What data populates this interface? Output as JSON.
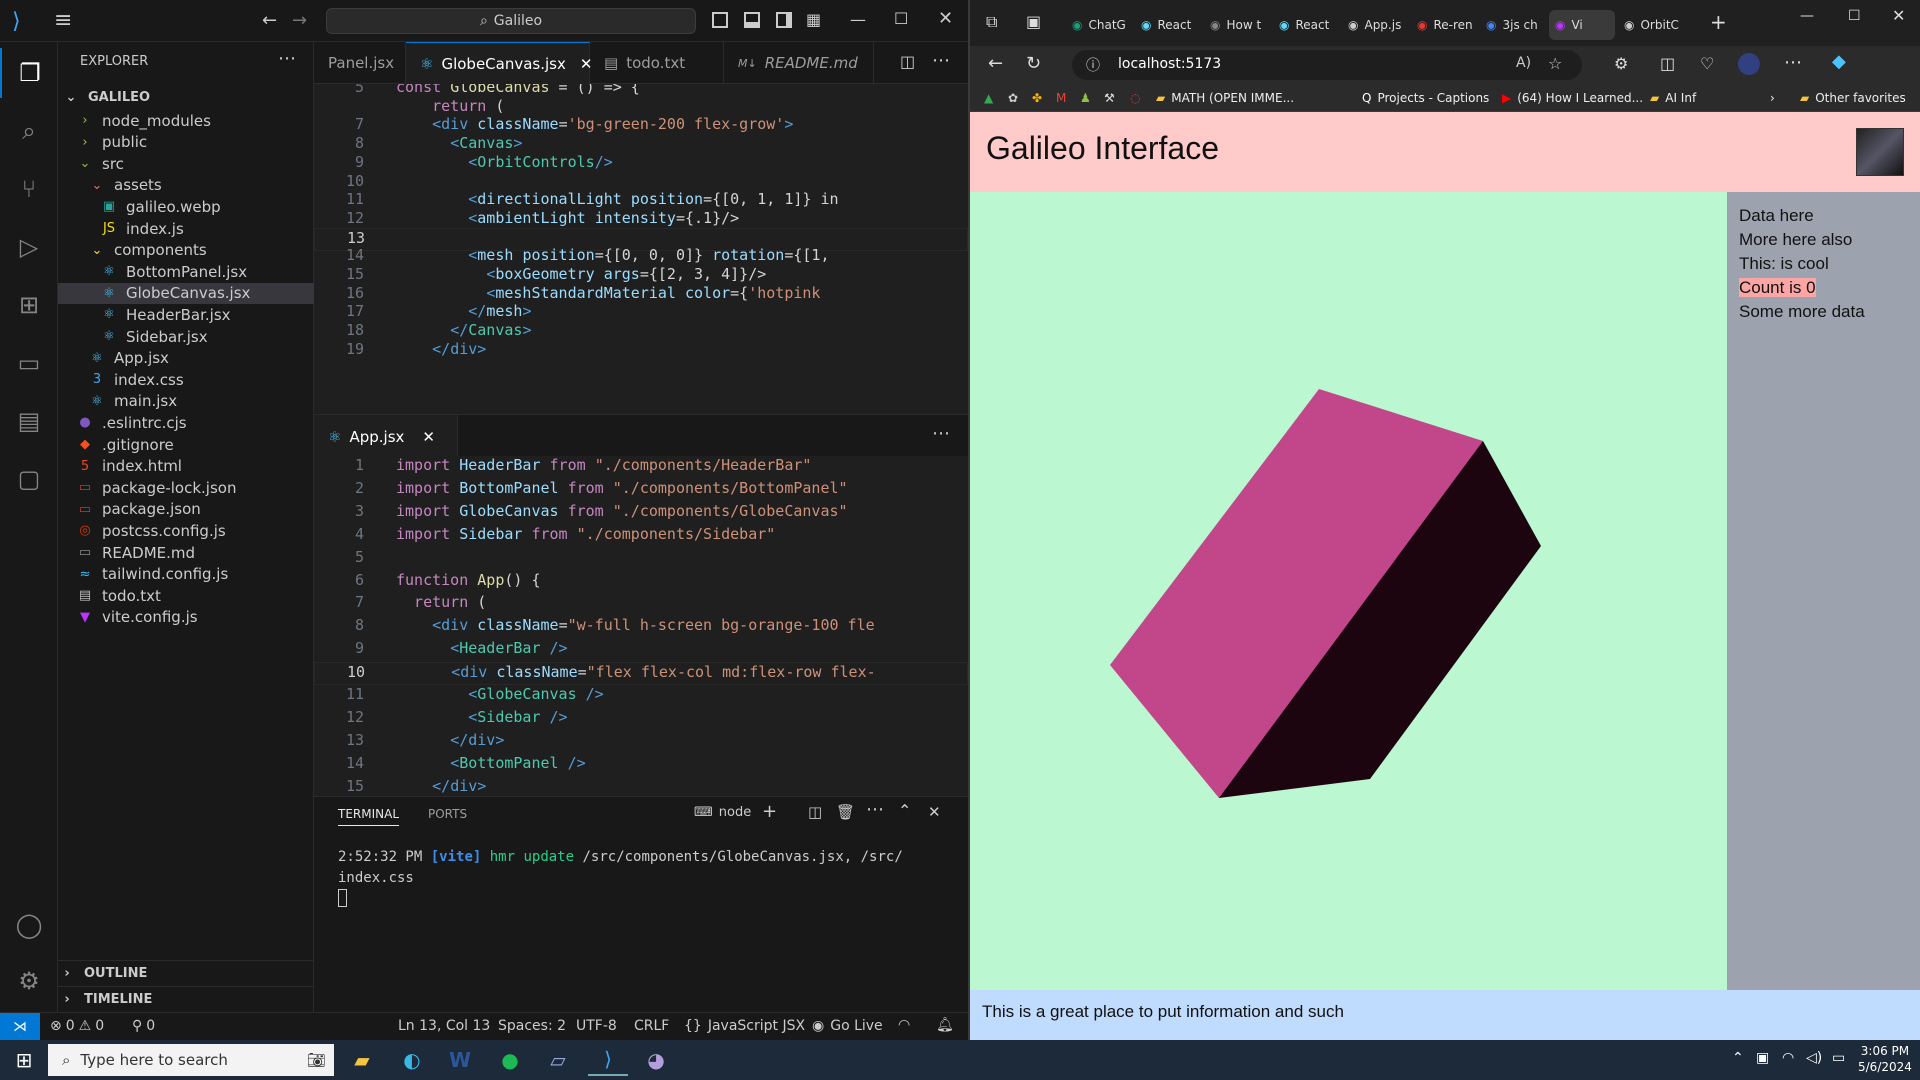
{
  "vscode": {
    "search": "Galileo",
    "explorer_title": "EXPLORER",
    "root": "GALILEO",
    "tree": [
      {
        "label": "node_modules",
        "icon": "›",
        "icolor": "#8bc34a",
        "depth": 1,
        "type": "folder"
      },
      {
        "label": "public",
        "icon": "›",
        "icolor": "#8bc34a",
        "depth": 1,
        "type": "folder"
      },
      {
        "label": "src",
        "icon": "⌄",
        "icolor": "#8bc34a",
        "depth": 1,
        "type": "folder"
      },
      {
        "label": "assets",
        "icon": "⌄",
        "icolor": "#e57373",
        "depth": 2,
        "type": "folder"
      },
      {
        "label": "galileo.webp",
        "icon": "▣",
        "icolor": "#26a69a",
        "depth": 3,
        "type": "file"
      },
      {
        "label": "index.js",
        "icon": "JS",
        "icolor": "#f5de19",
        "depth": 3,
        "type": "file"
      },
      {
        "label": "components",
        "icon": "⌄",
        "icolor": "#fdd835",
        "depth": 2,
        "type": "folder"
      },
      {
        "label": "BottomPanel.jsx",
        "icon": "⚛",
        "icolor": "#4fc3f7",
        "depth": 3,
        "type": "file"
      },
      {
        "label": "GlobeCanvas.jsx",
        "icon": "⚛",
        "icolor": "#4fc3f7",
        "depth": 3,
        "type": "file",
        "selected": true
      },
      {
        "label": "HeaderBar.jsx",
        "icon": "⚛",
        "icolor": "#4fc3f7",
        "depth": 3,
        "type": "file"
      },
      {
        "label": "Sidebar.jsx",
        "icon": "⚛",
        "icolor": "#4fc3f7",
        "depth": 3,
        "type": "file"
      },
      {
        "label": "App.jsx",
        "icon": "⚛",
        "icolor": "#4fc3f7",
        "depth": 2,
        "type": "file"
      },
      {
        "label": "index.css",
        "icon": "3",
        "icolor": "#42a5f5",
        "depth": 2,
        "type": "file"
      },
      {
        "label": "main.jsx",
        "icon": "⚛",
        "icolor": "#4fc3f7",
        "depth": 2,
        "type": "file"
      },
      {
        "label": ".eslintrc.cjs",
        "icon": "●",
        "icolor": "#7e57c2",
        "depth": 1,
        "type": "file"
      },
      {
        "label": ".gitignore",
        "icon": "◆",
        "icolor": "#f4511e",
        "depth": 1,
        "type": "file"
      },
      {
        "label": "index.html",
        "icon": "5",
        "icolor": "#e44d26",
        "depth": 1,
        "type": "file"
      },
      {
        "label": "package-lock.json",
        "icon": "▭",
        "icolor": "#cb3837",
        "depth": 1,
        "type": "file"
      },
      {
        "label": "package.json",
        "icon": "▭",
        "icolor": "#cb3837",
        "depth": 1,
        "type": "file"
      },
      {
        "label": "postcss.config.js",
        "icon": "◎",
        "icolor": "#dd3a0a",
        "depth": 1,
        "type": "file"
      },
      {
        "label": "README.md",
        "icon": "▭",
        "icolor": "#8a8a8a",
        "depth": 1,
        "type": "file"
      },
      {
        "label": "tailwind.config.js",
        "icon": "≈",
        "icolor": "#38bdf8",
        "depth": 1,
        "type": "file"
      },
      {
        "label": "todo.txt",
        "icon": "▤",
        "icolor": "#bbbbbb",
        "depth": 1,
        "type": "file"
      },
      {
        "label": "vite.config.js",
        "icon": "▼",
        "icolor": "#bd34fe",
        "depth": 1,
        "type": "file"
      }
    ],
    "outline": "OUTLINE",
    "timeline": "TIMELINE",
    "tabs": [
      {
        "label": "Panel.jsx",
        "icon": ""
      },
      {
        "label": "GlobeCanvas.jsx",
        "icon": "⚛",
        "active": true
      },
      {
        "label": "todo.txt",
        "icon": "▤"
      },
      {
        "label": "README.md",
        "icon": "M↓"
      }
    ],
    "editor1": [
      {
        "n": "5",
        "t": [
          [
            "kw",
            "const "
          ],
          [
            "fn",
            "GlobeCanvas"
          ],
          [
            "pn",
            " = () => {"
          ]
        ]
      },
      {
        "n": "",
        "t": [
          [
            "kw",
            "    return "
          ],
          [
            "pn",
            "("
          ]
        ]
      },
      {
        "n": "7",
        "t": [
          [
            "pn",
            "    "
          ],
          [
            "tg",
            "<"
          ],
          [
            "tg",
            "div "
          ],
          [
            "at",
            "className"
          ],
          [
            "pn",
            "="
          ],
          [
            "st",
            "'bg-green-200 flex-grow'"
          ],
          [
            "tg",
            ">"
          ]
        ]
      },
      {
        "n": "8",
        "t": [
          [
            "pn",
            "      "
          ],
          [
            "tg",
            "<"
          ],
          [
            "tgn",
            "Canvas"
          ],
          [
            "tg",
            ">"
          ]
        ]
      },
      {
        "n": "9",
        "t": [
          [
            "pn",
            "        "
          ],
          [
            "tg",
            "<"
          ],
          [
            "tgn",
            "OrbitControls"
          ],
          [
            "tg",
            "/>"
          ]
        ]
      },
      {
        "n": "10",
        "t": []
      },
      {
        "n": "11",
        "t": [
          [
            "pn",
            "        "
          ],
          [
            "tg",
            "<"
          ],
          [
            "at",
            "directionalLight "
          ],
          [
            "at",
            "position"
          ],
          [
            "pn",
            "={[0, 1, 1]} in"
          ]
        ]
      },
      {
        "n": "12",
        "t": [
          [
            "pn",
            "        "
          ],
          [
            "tg",
            "<"
          ],
          [
            "at",
            "ambientLight "
          ],
          [
            "at",
            "intensity"
          ],
          [
            "pn",
            "={.1}/>"
          ]
        ]
      },
      {
        "n": "13",
        "t": [],
        "cur": true
      },
      {
        "n": "14",
        "t": [
          [
            "pn",
            "        "
          ],
          [
            "tg",
            "<"
          ],
          [
            "at",
            "mesh "
          ],
          [
            "at",
            "position"
          ],
          [
            "pn",
            "={[0, 0, 0]} "
          ],
          [
            "at",
            "rotation"
          ],
          [
            "pn",
            "={[1,"
          ]
        ]
      },
      {
        "n": "15",
        "t": [
          [
            "pn",
            "          "
          ],
          [
            "tg",
            "<"
          ],
          [
            "at",
            "boxGeometry "
          ],
          [
            "at",
            "args"
          ],
          [
            "pn",
            "={[2, 3, 4]}/>"
          ]
        ]
      },
      {
        "n": "16",
        "t": [
          [
            "pn",
            "          "
          ],
          [
            "tg",
            "<"
          ],
          [
            "at",
            "meshStandardMaterial "
          ],
          [
            "at",
            "color"
          ],
          [
            "pn",
            "={"
          ],
          [
            "st",
            "'hotpink"
          ]
        ]
      },
      {
        "n": "17",
        "t": [
          [
            "pn",
            "        "
          ],
          [
            "tg",
            "</"
          ],
          [
            "at",
            "mesh"
          ],
          [
            "tg",
            ">"
          ]
        ]
      },
      {
        "n": "18",
        "t": [
          [
            "pn",
            "      "
          ],
          [
            "tg",
            "</"
          ],
          [
            "tgn",
            "Canvas"
          ],
          [
            "tg",
            ">"
          ]
        ]
      },
      {
        "n": "19",
        "t": [
          [
            "pn",
            "    "
          ],
          [
            "tg",
            "</"
          ],
          [
            "tg",
            "div"
          ],
          [
            "tg",
            ">"
          ]
        ]
      }
    ],
    "app_tab": "App.jsx",
    "editor2": [
      {
        "n": "1",
        "t": [
          [
            "kw",
            "import "
          ],
          [
            "at",
            "HeaderBar "
          ],
          [
            "kw",
            "from "
          ],
          [
            "st",
            "\"./components/HeaderBar\""
          ]
        ]
      },
      {
        "n": "2",
        "t": [
          [
            "kw",
            "import "
          ],
          [
            "at",
            "BottomPanel "
          ],
          [
            "kw",
            "from "
          ],
          [
            "st",
            "\"./components/BottomPanel\""
          ]
        ]
      },
      {
        "n": "3",
        "t": [
          [
            "kw",
            "import "
          ],
          [
            "at",
            "GlobeCanvas "
          ],
          [
            "kw",
            "from "
          ],
          [
            "st",
            "\"./components/GlobeCanvas\""
          ]
        ]
      },
      {
        "n": "4",
        "t": [
          [
            "kw",
            "import "
          ],
          [
            "at",
            "Sidebar "
          ],
          [
            "kw",
            "from "
          ],
          [
            "st",
            "\"./components/Sidebar\""
          ]
        ]
      },
      {
        "n": "5",
        "t": []
      },
      {
        "n": "6",
        "t": [
          [
            "kw",
            "function "
          ],
          [
            "fn",
            "App"
          ],
          [
            "pn",
            "() {"
          ]
        ]
      },
      {
        "n": "7",
        "t": [
          [
            "kw",
            "  return "
          ],
          [
            "pn",
            "("
          ]
        ]
      },
      {
        "n": "8",
        "t": [
          [
            "pn",
            "    "
          ],
          [
            "tg",
            "<"
          ],
          [
            "tg",
            "div "
          ],
          [
            "at",
            "className"
          ],
          [
            "pn",
            "="
          ],
          [
            "st",
            "\"w-full h-screen bg-orange-100 fle"
          ]
        ]
      },
      {
        "n": "9",
        "t": [
          [
            "pn",
            "      "
          ],
          [
            "tg",
            "<"
          ],
          [
            "tgn",
            "HeaderBar "
          ],
          [
            "tg",
            "/>"
          ]
        ]
      },
      {
        "n": "10",
        "t": [
          [
            "pn",
            "      "
          ],
          [
            "tg",
            "<"
          ],
          [
            "tg",
            "div "
          ],
          [
            "at",
            "className"
          ],
          [
            "pn",
            "="
          ],
          [
            "st",
            "\"flex flex-col md:flex-row flex-"
          ]
        ],
        "cur": true
      },
      {
        "n": "11",
        "t": [
          [
            "pn",
            "        "
          ],
          [
            "tg",
            "<"
          ],
          [
            "tgn",
            "GlobeCanvas "
          ],
          [
            "tg",
            "/>"
          ]
        ]
      },
      {
        "n": "12",
        "t": [
          [
            "pn",
            "        "
          ],
          [
            "tg",
            "<"
          ],
          [
            "tgn",
            "Sidebar "
          ],
          [
            "tg",
            "/>"
          ]
        ]
      },
      {
        "n": "13",
        "t": [
          [
            "pn",
            "      "
          ],
          [
            "tg",
            "</"
          ],
          [
            "tg",
            "div"
          ],
          [
            "tg",
            ">"
          ]
        ]
      },
      {
        "n": "14",
        "t": [
          [
            "pn",
            "      "
          ],
          [
            "tg",
            "<"
          ],
          [
            "tgn",
            "BottomPanel "
          ],
          [
            "tg",
            "/>"
          ]
        ]
      },
      {
        "n": "15",
        "t": [
          [
            "pn",
            "    "
          ],
          [
            "tg",
            "</"
          ],
          [
            "tg",
            "div"
          ],
          [
            "tg",
            ">"
          ]
        ]
      }
    ],
    "terminal": {
      "tab": "TERMINAL",
      "ports": "PORTS",
      "shell": "node",
      "line1_time": "2:52:32 PM",
      "line1_tag": "[vite]",
      "line1_msg": "hmr update",
      "line1_path": "/src/components/GlobeCanvas.jsx, /src/",
      "line2": "index.css"
    },
    "status": {
      "errors": "0",
      "warnings": "0",
      "ports": "0",
      "position": "Ln 13, Col 13",
      "spaces": "Spaces: 2",
      "encoding": "UTF-8",
      "eol": "CRLF",
      "lang": "JavaScript JSX",
      "golive": "Go Live"
    }
  },
  "browser": {
    "tabs": [
      "ChatG",
      "React",
      "How t",
      "React",
      "App.js",
      "Re-ren",
      "3js ch",
      "Vi",
      "OrbitC"
    ],
    "url": "localhost:5173",
    "favorites": [
      "MATH (OPEN IMME...",
      "Projects - Captions",
      "(64) How I Learned...",
      "AI Inf"
    ],
    "other_favorites": "Other favorites",
    "page": {
      "title": "Galileo Interface",
      "sidebar": [
        "Data here",
        "More here also",
        "This: is cool",
        "Count is 0",
        "Some more data"
      ],
      "footer": "This is a great place to put information and such",
      "colors": {
        "header": "#fecaca",
        "canvas": "#bbf7d0",
        "sidebar": "#9ca3af",
        "footer": "#bfdbfe",
        "box_light": "#c2468a",
        "box_dark": "#1d0510",
        "count_hl": "#fca5a5"
      }
    }
  },
  "taskbar": {
    "search_placeholder": "Type here to search",
    "time": "3:06 PM",
    "date": "5/6/2024"
  }
}
